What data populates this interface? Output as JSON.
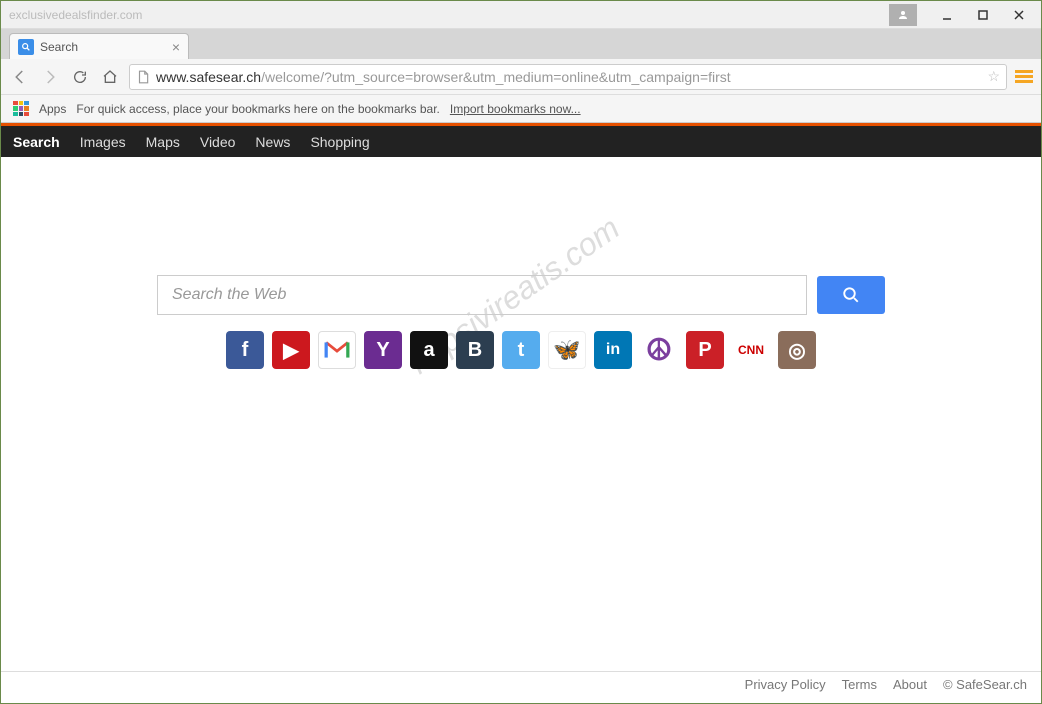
{
  "titlebar": {
    "text": "exclusivedealsfinder.com"
  },
  "tab": {
    "title": "Search"
  },
  "url": {
    "domain": "www.safesear.ch",
    "path": "/welcome/?utm_source=browser&utm_medium=online&utm_campaign=first"
  },
  "bookmarks": {
    "apps_label": "Apps",
    "hint": "For quick access, place your bookmarks here on the bookmarks bar.",
    "import_link": "Import bookmarks now..."
  },
  "nav": {
    "items": [
      "Search",
      "Images",
      "Maps",
      "Video",
      "News",
      "Shopping"
    ],
    "active": 0
  },
  "search": {
    "placeholder": "Search the Web"
  },
  "icons": [
    {
      "name": "facebook",
      "label": "f",
      "cls": "fb"
    },
    {
      "name": "youtube",
      "label": "▶",
      "cls": "yt"
    },
    {
      "name": "gmail",
      "label": "M",
      "cls": "gm"
    },
    {
      "name": "yahoo",
      "label": "Y",
      "cls": "yh"
    },
    {
      "name": "amazon",
      "label": "a",
      "cls": "am"
    },
    {
      "name": "vk",
      "label": "B",
      "cls": "vk"
    },
    {
      "name": "twitter",
      "label": "t",
      "cls": "tw"
    },
    {
      "name": "butterfly",
      "label": "ఌ",
      "cls": "bf"
    },
    {
      "name": "linkedin",
      "label": "in",
      "cls": "li"
    },
    {
      "name": "peace",
      "label": "☮",
      "cls": "pc"
    },
    {
      "name": "pinterest",
      "label": "P",
      "cls": "pn"
    },
    {
      "name": "cnn",
      "label": "CNN",
      "cls": "cn"
    },
    {
      "name": "instagram",
      "label": "◎",
      "cls": "ig"
    }
  ],
  "footer": {
    "links": [
      "Privacy Policy",
      "Terms",
      "About"
    ],
    "copyright": "© SafeSear.ch"
  },
  "watermark": "httpsivireatis.com"
}
